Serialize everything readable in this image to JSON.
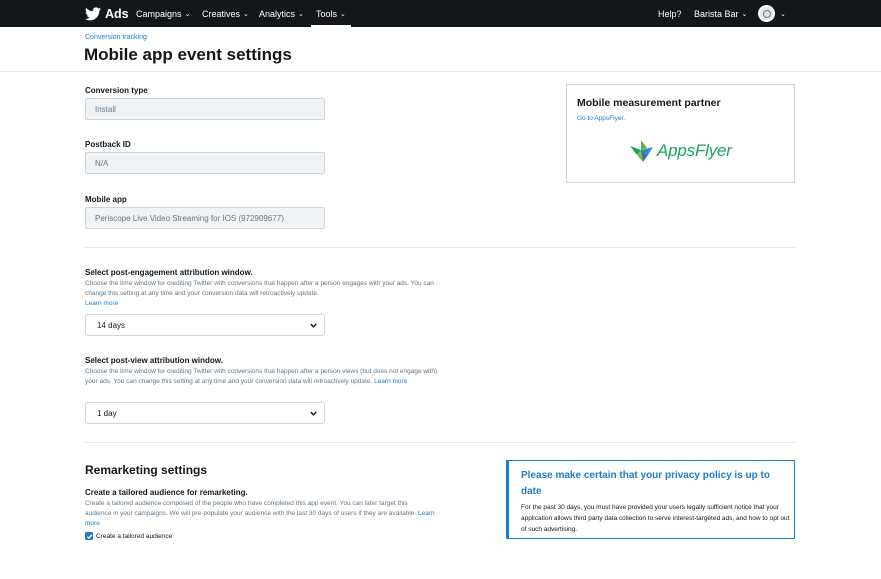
{
  "nav": {
    "brand": "Ads",
    "items": [
      "Campaigns",
      "Creatives",
      "Analytics",
      "Tools"
    ],
    "help": "Help?",
    "account": "Barista Bar"
  },
  "header": {
    "breadcrumb": "Conversion tracking",
    "title": "Mobile app event settings"
  },
  "form": {
    "conversion_type": {
      "label": "Conversion type",
      "value": "Install"
    },
    "postback_id": {
      "label": "Postback ID",
      "value": "N/A"
    },
    "mobile_app": {
      "label": "Mobile app",
      "value": "Periscope Live Video Streaming for IOS (972909677)"
    }
  },
  "partner": {
    "title": "Mobile measurement partner",
    "link": "Go to AppsFlyer.",
    "logo_text": "AppsFlyer"
  },
  "engagement_window": {
    "label": "Select post-engagement attribution window.",
    "help": "Choose the time window for crediting Twitter with conversions that happen after a person engages with your ads. You can change this setting at any time and your conversion data will retroactively update.",
    "learn_more": "Learn more",
    "value": "14 days"
  },
  "view_window": {
    "label": "Select post-view attribution window.",
    "help": "Choose the time window for crediting Twitter with conversions that happen after a person views (but does not engage with) your ads. You can change this setting at any time and your conversion data will retroactively update.",
    "learn_more": "Learn more",
    "value": "1 day"
  },
  "remarketing": {
    "title": "Remarketing settings",
    "label": "Create a tailored audience for remarketing.",
    "help": "Create a tailored audience composed of the people who have completed this app event. You can later target this audience in your campaigns. We will pre-populate your audience with the last 30 days of users if they are available.",
    "learn_more": "Learn more",
    "checkbox_label": "Create a tailored audience"
  },
  "privacy": {
    "title": "Please make certain that your privacy policy is up to date",
    "body": "For the past 30 days, you must have provided your users legally sufficient notice that your application allows third party data collection to serve interest-targeted ads, and how to opt out of such advertising."
  },
  "colors": {
    "nav_bg": "#14171a",
    "link": "#1d7ecb",
    "appsflyer_green": "#1aa35a"
  }
}
